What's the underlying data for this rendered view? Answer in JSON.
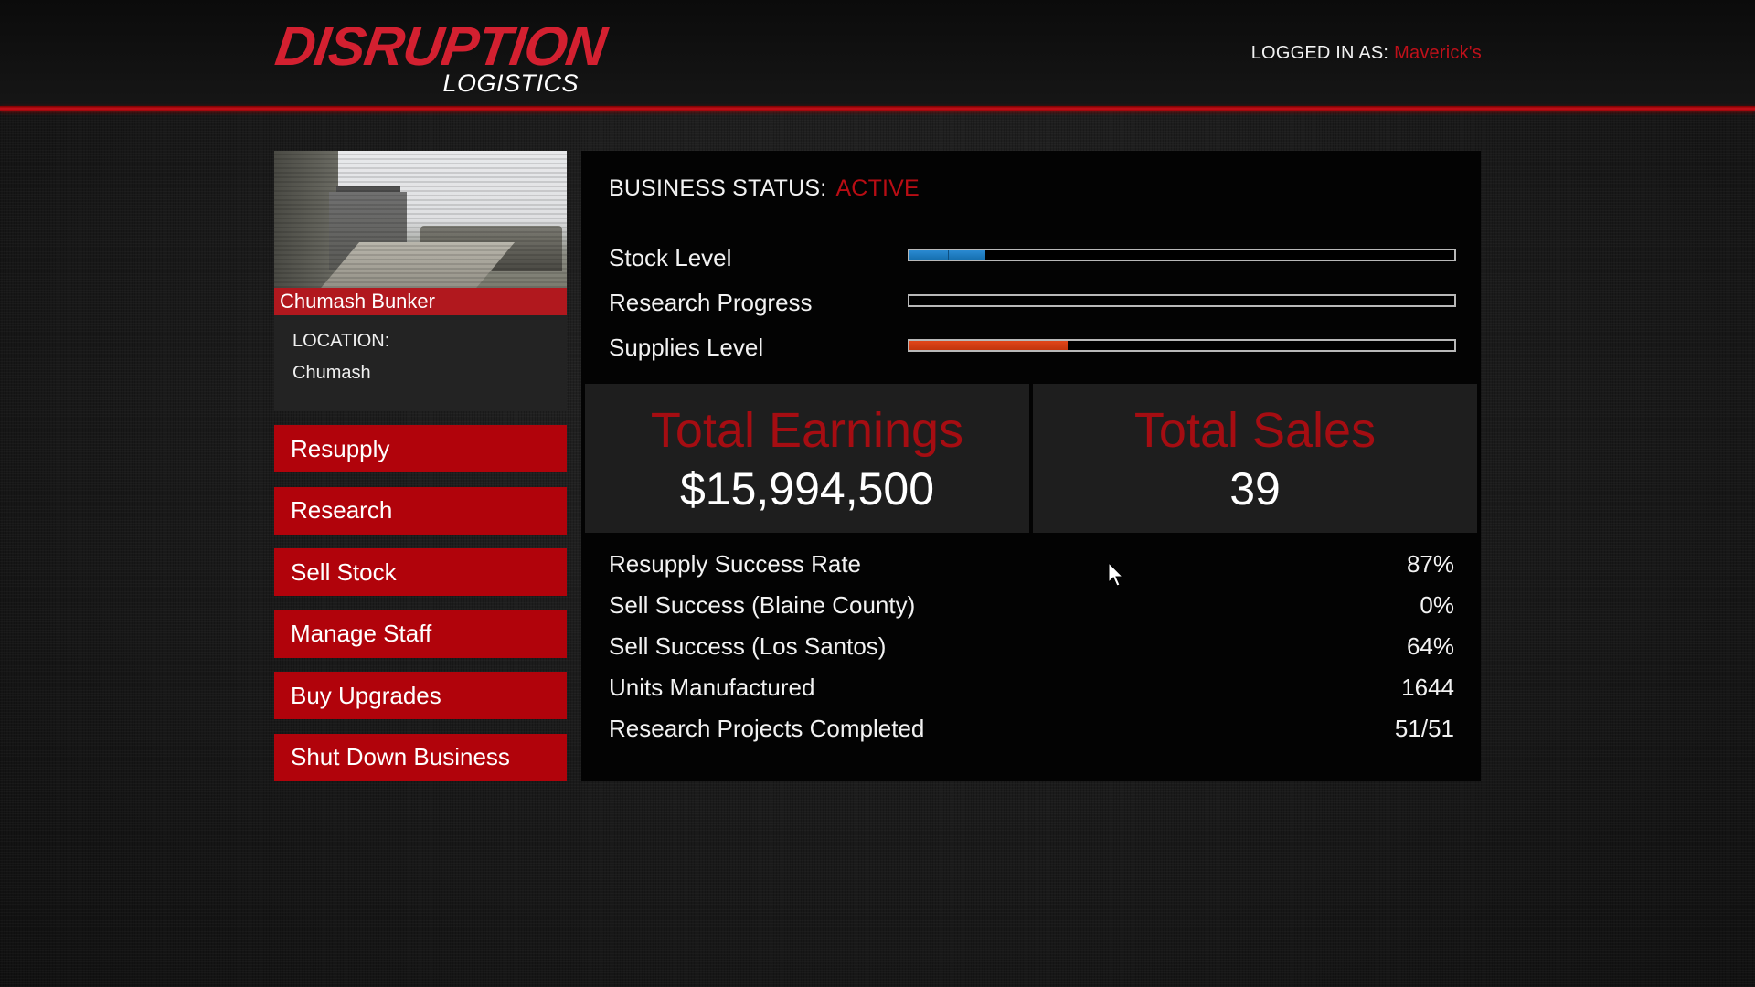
{
  "header": {
    "logo_main": "DISRUPTION",
    "logo_sub": "LOGISTICS",
    "logged_in_label": "LOGGED IN AS:",
    "logged_in_user": "Maverick's"
  },
  "business": {
    "name": "Chumash Bunker",
    "location_label": "LOCATION:",
    "location_value": "Chumash"
  },
  "menu": {
    "items": [
      {
        "label": "Resupply"
      },
      {
        "label": "Research"
      },
      {
        "label": "Sell Stock"
      },
      {
        "label": "Manage Staff"
      },
      {
        "label": "Buy Upgrades"
      },
      {
        "label": "Shut Down Business"
      }
    ]
  },
  "status": {
    "label": "BUSINESS STATUS:",
    "value": "ACTIVE"
  },
  "meters": [
    {
      "label": "Stock Level",
      "percent": 14,
      "color": "#1e7fc4"
    },
    {
      "label": "Research Progress",
      "percent": 0,
      "color": "#1e7fc4"
    },
    {
      "label": "Supplies Level",
      "percent": 29,
      "color": "#d23e13"
    }
  ],
  "totals": {
    "earnings_label": "Total Earnings",
    "earnings_value": "$15,994,500",
    "sales_label": "Total Sales",
    "sales_value": "39"
  },
  "stats": [
    {
      "label": "Resupply Success Rate",
      "value": "87%"
    },
    {
      "label": "Sell Success (Blaine County)",
      "value": "0%"
    },
    {
      "label": "Sell Success (Los Santos)",
      "value": "64%"
    },
    {
      "label": "Units Manufactured",
      "value": "1644"
    },
    {
      "label": "Research Projects Completed",
      "value": "51/51"
    }
  ],
  "colors": {
    "accent_red": "#b1030b",
    "header_line": "#c8101a",
    "status_red": "#b80d14"
  }
}
